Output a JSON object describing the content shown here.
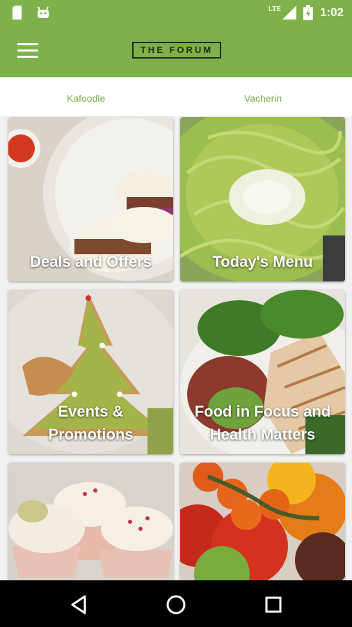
{
  "status_bar": {
    "network": "LTE",
    "time": "1:02"
  },
  "app_bar": {
    "logo": "THE FORUM"
  },
  "tabs": [
    {
      "label": "Kafoodle"
    },
    {
      "label": "Vacherin"
    }
  ],
  "cards": [
    {
      "label": "Deals and Offers"
    },
    {
      "label": "Today's Menu"
    },
    {
      "label": "Events &\nPromotions"
    },
    {
      "label": "Food in Focus and\nHealth Matters"
    },
    {
      "label": ""
    },
    {
      "label": ""
    }
  ],
  "colors": {
    "primary": "#7fb04a",
    "nav_bar": "#000000"
  }
}
